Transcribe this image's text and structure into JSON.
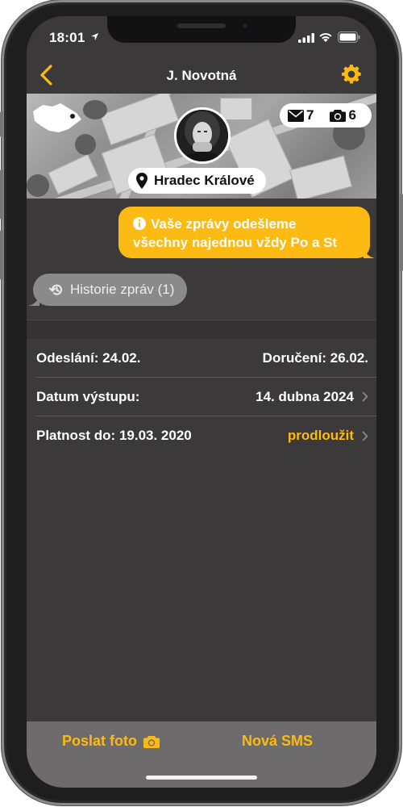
{
  "status_bar": {
    "time": "18:01"
  },
  "nav": {
    "title": "J. Novotná"
  },
  "header": {
    "message_count": "7",
    "photo_count": "6",
    "location": "Hradec Králové"
  },
  "info_bubble": {
    "line1": "Vaše zprávy odešleme",
    "line2": "všechny najednou vždy Po a St"
  },
  "history": {
    "label": "Historie zpráv (1)"
  },
  "details": {
    "sent_label": "Odeslání: 24.02.",
    "delivered_label": "Doručení: 26.02.",
    "output_date_label": "Datum výstupu:",
    "output_date_value": "14. dubna 2024",
    "validity_label": "Platnost do: 19.03. 2020",
    "extend_label": "prodloužit"
  },
  "bottom_bar": {
    "send_photo_label": "Poslat foto",
    "new_sms_label": "Nová SMS"
  },
  "colors": {
    "accent": "#fcba12",
    "background": "#3b3939",
    "bottom_bar": "#6d6b6b",
    "history_bubble": "#8b8a8a"
  },
  "icons": {
    "back": "chevron-left-icon",
    "settings": "gear-icon",
    "messages": "envelope-icon",
    "photos": "camera-icon",
    "location": "map-pin-icon",
    "info": "info-icon",
    "history": "history-icon"
  }
}
